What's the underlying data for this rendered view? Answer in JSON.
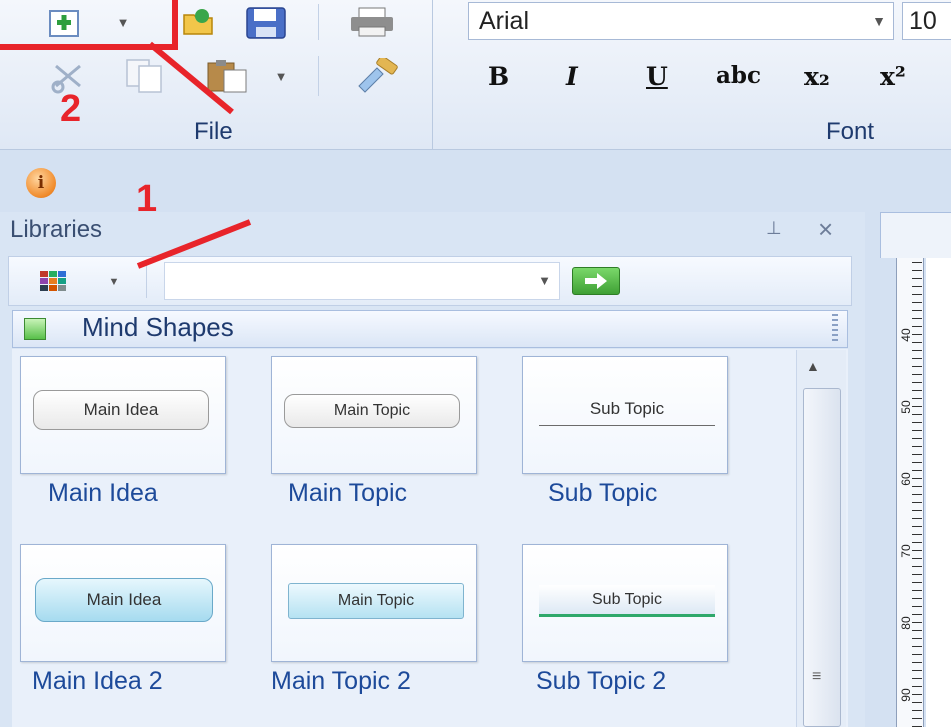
{
  "ribbon": {
    "groups": [
      {
        "label": "File"
      },
      {
        "label": "Font"
      }
    ],
    "font": {
      "family_value": "Arial",
      "size_value": "10"
    },
    "format_buttons": [
      {
        "name": "bold-button",
        "label": "B"
      },
      {
        "name": "italic-button",
        "label": "I"
      },
      {
        "name": "underline-button",
        "label": "U"
      },
      {
        "name": "strikethrough-button",
        "label": "abc"
      },
      {
        "name": "subscript-button",
        "label": "x₂"
      },
      {
        "name": "superscript-button",
        "label": "x²"
      }
    ]
  },
  "info": {
    "icon_text": "i"
  },
  "libraries": {
    "title": "Libraries",
    "combo_value": "",
    "category": "Mind Shapes",
    "items": [
      {
        "shape_text": "Main Idea",
        "label": "Main Idea"
      },
      {
        "shape_text": "Main Topic",
        "label": "Main Topic"
      },
      {
        "shape_text": "Sub Topic",
        "label": "Sub Topic"
      },
      {
        "shape_text": "Main Idea",
        "label": "Main Idea 2"
      },
      {
        "shape_text": "Main Topic",
        "label": "Main Topic 2"
      },
      {
        "shape_text": "Sub Topic",
        "label": "Sub Topic 2"
      }
    ]
  },
  "ruler": {
    "labels": [
      "40",
      "50",
      "60",
      "70",
      "80",
      "90"
    ]
  },
  "annotations": {
    "one": "1",
    "two": "2"
  },
  "colors": {
    "annotation": "#e8242a",
    "accent": "#1d4a9a"
  }
}
